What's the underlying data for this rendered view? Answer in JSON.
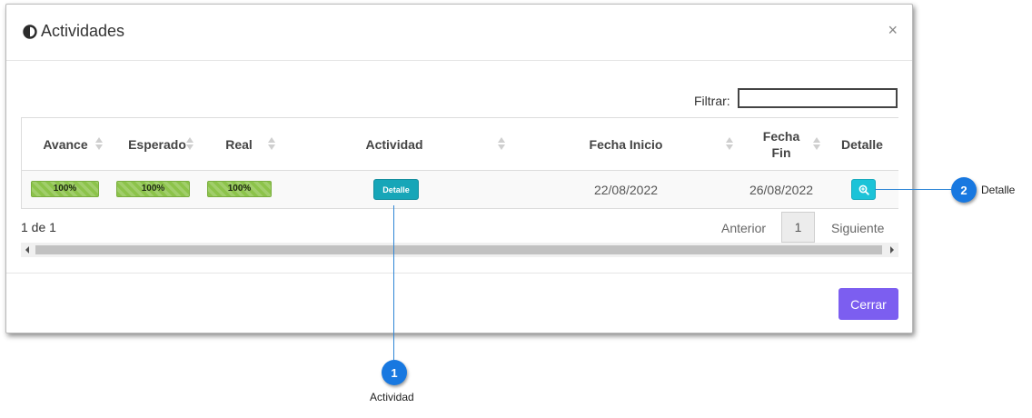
{
  "modal": {
    "title": "Actividades",
    "close_glyph": "×",
    "title_icon": "half-circle-icon"
  },
  "filter": {
    "label": "Filtrar:",
    "value": ""
  },
  "table": {
    "headers": {
      "avance": "Avance",
      "esperado": "Esperado",
      "real": "Real",
      "actividad": "Actividad",
      "fecha_inicio": "Fecha Inicio",
      "fecha_fin_line1": "Fecha",
      "fecha_fin_line2": "Fin",
      "detalle": "Detalle"
    },
    "rows": [
      {
        "avance": "100%",
        "avance_value": 100,
        "esperado": "100%",
        "esperado_value": 100,
        "real": "100%",
        "real_value": 100,
        "actividad_button": "Detalle",
        "fecha_inicio": "22/08/2022",
        "fecha_fin": "26/08/2022",
        "detalle_icon": "zoom-in-icon"
      }
    ]
  },
  "pagination": {
    "info": "1 de 1",
    "prev": "Anterior",
    "current_page": "1",
    "next": "Siguiente"
  },
  "footer": {
    "close_button": "Cerrar"
  },
  "callouts": [
    {
      "number": "1",
      "label": "Actividad"
    },
    {
      "number": "2",
      "label": "Detalle"
    }
  ],
  "colors": {
    "progress": "#8cc34a",
    "detalle_button": "#17a6b8",
    "detalle_icon_button": "#1cc3d8",
    "cerrar_button": "#7c5ef0",
    "callout": "#1878e0"
  }
}
